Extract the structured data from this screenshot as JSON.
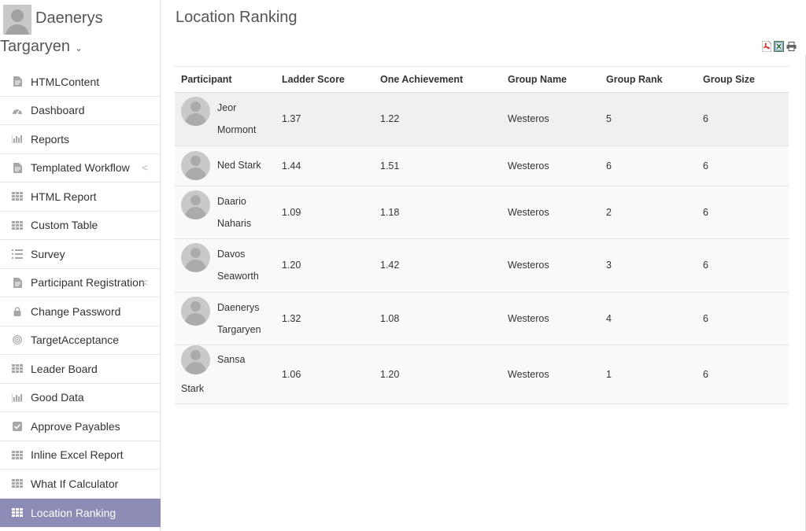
{
  "user": {
    "first_name": "Daenerys",
    "last_name": "Targaryen",
    "caret": "⌄"
  },
  "sidebar": {
    "items": [
      {
        "label": "HTMLContent",
        "icon": "document-icon"
      },
      {
        "label": "Dashboard",
        "icon": "gauge-icon"
      },
      {
        "label": "Reports",
        "icon": "bar-chart-icon"
      },
      {
        "label": "Templated Workflow",
        "icon": "document-icon",
        "chevron": "<"
      },
      {
        "label": "HTML Report",
        "icon": "grid-icon"
      },
      {
        "label": "Custom Table",
        "icon": "grid-icon"
      },
      {
        "label": "Survey",
        "icon": "list-icon"
      },
      {
        "label": "Participant Registration",
        "icon": "document-icon",
        "chevron": "<"
      },
      {
        "label": "Change Password",
        "icon": "lock-icon"
      },
      {
        "label": "TargetAcceptance",
        "icon": "target-icon"
      },
      {
        "label": "Leader Board",
        "icon": "grid-icon"
      },
      {
        "label": "Good Data",
        "icon": "bar-chart-icon"
      },
      {
        "label": "Approve Payables",
        "icon": "checkbox-icon"
      },
      {
        "label": "Inline Excel Report",
        "icon": "grid-icon"
      },
      {
        "label": "What If Calculator",
        "icon": "grid-icon"
      },
      {
        "label": "Location Ranking",
        "icon": "grid-icon",
        "active": true
      }
    ]
  },
  "page": {
    "title": "Location Ranking"
  },
  "table": {
    "headers": [
      "Participant",
      "Ladder Score",
      "One Achievement",
      "Group Name",
      "Group Rank",
      "Group Size"
    ],
    "rows": [
      {
        "participant": "Jeor Mormont",
        "ladder_score": "1.37",
        "one_achievement": "1.22",
        "group_name": "Westeros",
        "group_rank": "5",
        "group_size": "6"
      },
      {
        "participant": "Ned Stark",
        "ladder_score": "1.44",
        "one_achievement": "1.51",
        "group_name": "Westeros",
        "group_rank": "6",
        "group_size": "6"
      },
      {
        "participant": "Daario Naharis",
        "ladder_score": "1.09",
        "one_achievement": "1.18",
        "group_name": "Westeros",
        "group_rank": "2",
        "group_size": "6"
      },
      {
        "participant": "Davos Seaworth",
        "ladder_score": "1.20",
        "one_achievement": "1.42",
        "group_name": "Westeros",
        "group_rank": "3",
        "group_size": "6"
      },
      {
        "participant": "Daenerys Targaryen",
        "ladder_score": "1.32",
        "one_achievement": "1.08",
        "group_name": "Westeros",
        "group_rank": "4",
        "group_size": "6"
      },
      {
        "participant": "Sansa Stark",
        "ladder_score": "1.06",
        "one_achievement": "1.20",
        "group_name": "Westeros",
        "group_rank": "1",
        "group_size": "6"
      }
    ]
  },
  "export": {
    "icons": [
      "pdf-icon",
      "excel-icon",
      "print-icon"
    ]
  }
}
